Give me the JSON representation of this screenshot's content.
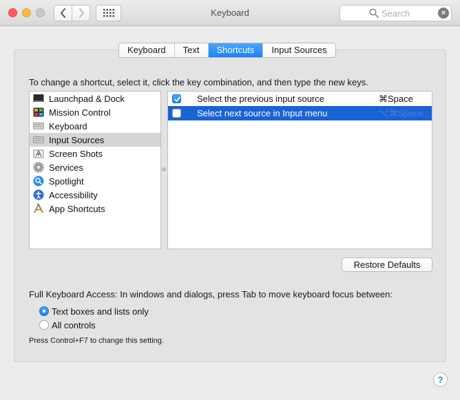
{
  "window": {
    "title": "Keyboard"
  },
  "toolbar": {
    "back_icon": "chevron-left-icon",
    "forward_icon": "chevron-right-icon",
    "grid_icon": "show-all-grid-icon",
    "search_placeholder": "Search",
    "clear_icon": "×"
  },
  "tabs": [
    {
      "label": "Keyboard",
      "active": false
    },
    {
      "label": "Text",
      "active": false
    },
    {
      "label": "Shortcuts",
      "active": true
    },
    {
      "label": "Input Sources",
      "active": false
    }
  ],
  "instructions": "To change a shortcut, select it, click the key combination, and then type the new keys.",
  "categories": [
    {
      "label": "Launchpad & Dock",
      "icon": "launchpad-dock-icon",
      "selected": false
    },
    {
      "label": "Mission Control",
      "icon": "mission-control-icon",
      "selected": false
    },
    {
      "label": "Keyboard",
      "icon": "keyboard-icon",
      "selected": false
    },
    {
      "label": "Input Sources",
      "icon": "input-sources-icon",
      "selected": true
    },
    {
      "label": "Screen Shots",
      "icon": "screen-shots-icon",
      "selected": false
    },
    {
      "label": "Services",
      "icon": "gear-icon",
      "selected": false
    },
    {
      "label": "Spotlight",
      "icon": "spotlight-icon",
      "selected": false
    },
    {
      "label": "Accessibility",
      "icon": "accessibility-icon",
      "selected": false
    },
    {
      "label": "App Shortcuts",
      "icon": "app-shortcuts-icon",
      "selected": false
    }
  ],
  "shortcuts": [
    {
      "label": "Select the previous input source",
      "key": "⌘Space",
      "checked": true,
      "selected": false
    },
    {
      "label": "Select next source in Input menu",
      "key": "⌥⌘Space",
      "checked": false,
      "selected": true
    }
  ],
  "restore_button": "Restore Defaults",
  "full_keyboard_access": {
    "label": "Full Keyboard Access: In windows and dialogs, press Tab to move keyboard focus between:",
    "options": [
      {
        "label": "Text boxes and lists only",
        "selected": true
      },
      {
        "label": "All controls",
        "selected": false
      }
    ],
    "note": "Press Control+F7 to change this setting."
  },
  "help_button": "?",
  "colors": {
    "accent": "#1a82f7",
    "selection": "#1a63d6"
  }
}
